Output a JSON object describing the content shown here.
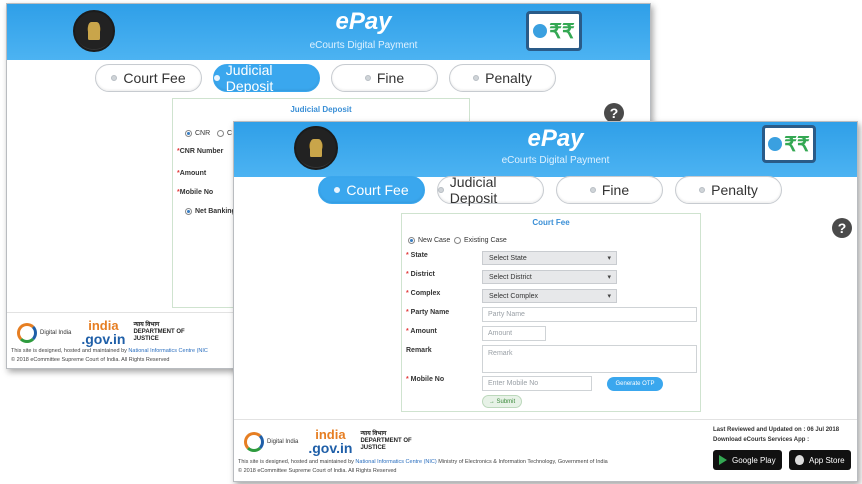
{
  "back_window": {
    "header": {
      "title": "ePay",
      "subtitle": "eCourts Digital Payment"
    },
    "tabs": [
      {
        "label": "Court Fee",
        "active": false
      },
      {
        "label": "Judicial Deposit",
        "active": true
      },
      {
        "label": "Fine",
        "active": false
      },
      {
        "label": "Penalty",
        "active": false
      }
    ],
    "help": "?",
    "form": {
      "title": "Judicial Deposit",
      "radio_cnr": "CNR",
      "radio_other": "C",
      "cnr_label": "CNR Number",
      "amount_label": "Amount",
      "mobile_label": "Mobile No",
      "payment_label": "Net Banking"
    },
    "footer": {
      "digital_india": "Digital India",
      "india_1": "india",
      "india_2": ".gov.in",
      "doj_hindi": "न्याय विभाग",
      "doj": "DEPARTMENT OF",
      "doj2": "JUSTICE",
      "line1_pre": "This site is designed, hosted and maintained by",
      "line1_link": "National Informatics Centre (NIC",
      "line2": "© 2018 eCommittee Supreme Court of India. All Rights Reserved"
    }
  },
  "front_window": {
    "header": {
      "title": "ePay",
      "subtitle": "eCourts Digital Payment"
    },
    "tabs": [
      {
        "label": "Court Fee",
        "active": true
      },
      {
        "label": "Judicial Deposit",
        "active": false
      },
      {
        "label": "Fine",
        "active": false
      },
      {
        "label": "Penalty",
        "active": false
      }
    ],
    "help": "?",
    "form": {
      "title": "Court Fee",
      "radio_new": "New Case",
      "radio_existing": "Existing Case",
      "state_label": "State",
      "state_value": "Select State",
      "district_label": "District",
      "district_value": "Select District",
      "complex_label": "Complex",
      "complex_value": "Select Complex",
      "party_label": "Party Name",
      "party_placeholder": "Party Name",
      "amount_label": "Amount",
      "amount_placeholder": "Amount",
      "remark_label": "Remark",
      "remark_placeholder": "Remark",
      "mobile_label": "Mobile No",
      "mobile_placeholder": "Enter Mobile No",
      "otp_button": "Generate OTP",
      "submit_button": "→ Submit"
    },
    "footer": {
      "digital_india": "Digital India",
      "india_1": "india",
      "india_2": ".gov.in",
      "doj_hindi": "न्याय विभाग",
      "doj": "DEPARTMENT OF",
      "doj2": "JUSTICE",
      "line1_pre": "This site is designed, hosted and maintained by",
      "line1_link": "National Informatics Centre (NIC)",
      "line1_post": "Ministry of Electronics & Information Technology, Government of India",
      "line2": "© 2018 eCommittee Supreme Court of India. All Rights Reserved",
      "updated": "Last Reviewed and Updated on : 06 Jul 2018",
      "download": "Download eCourts Services App :",
      "google_play": "Google Play",
      "app_store": "App Store"
    }
  },
  "colors": {
    "header_blue": "#3aa7ee",
    "active_tab": "#3aa7ee",
    "required": "#e23b3b",
    "rupee_green": "#34a853"
  },
  "icons": [
    "emblem-icon",
    "payment-icon",
    "help-icon",
    "chevron-down-icon",
    "digital-india-logo",
    "google-play-icon",
    "apple-icon"
  ]
}
